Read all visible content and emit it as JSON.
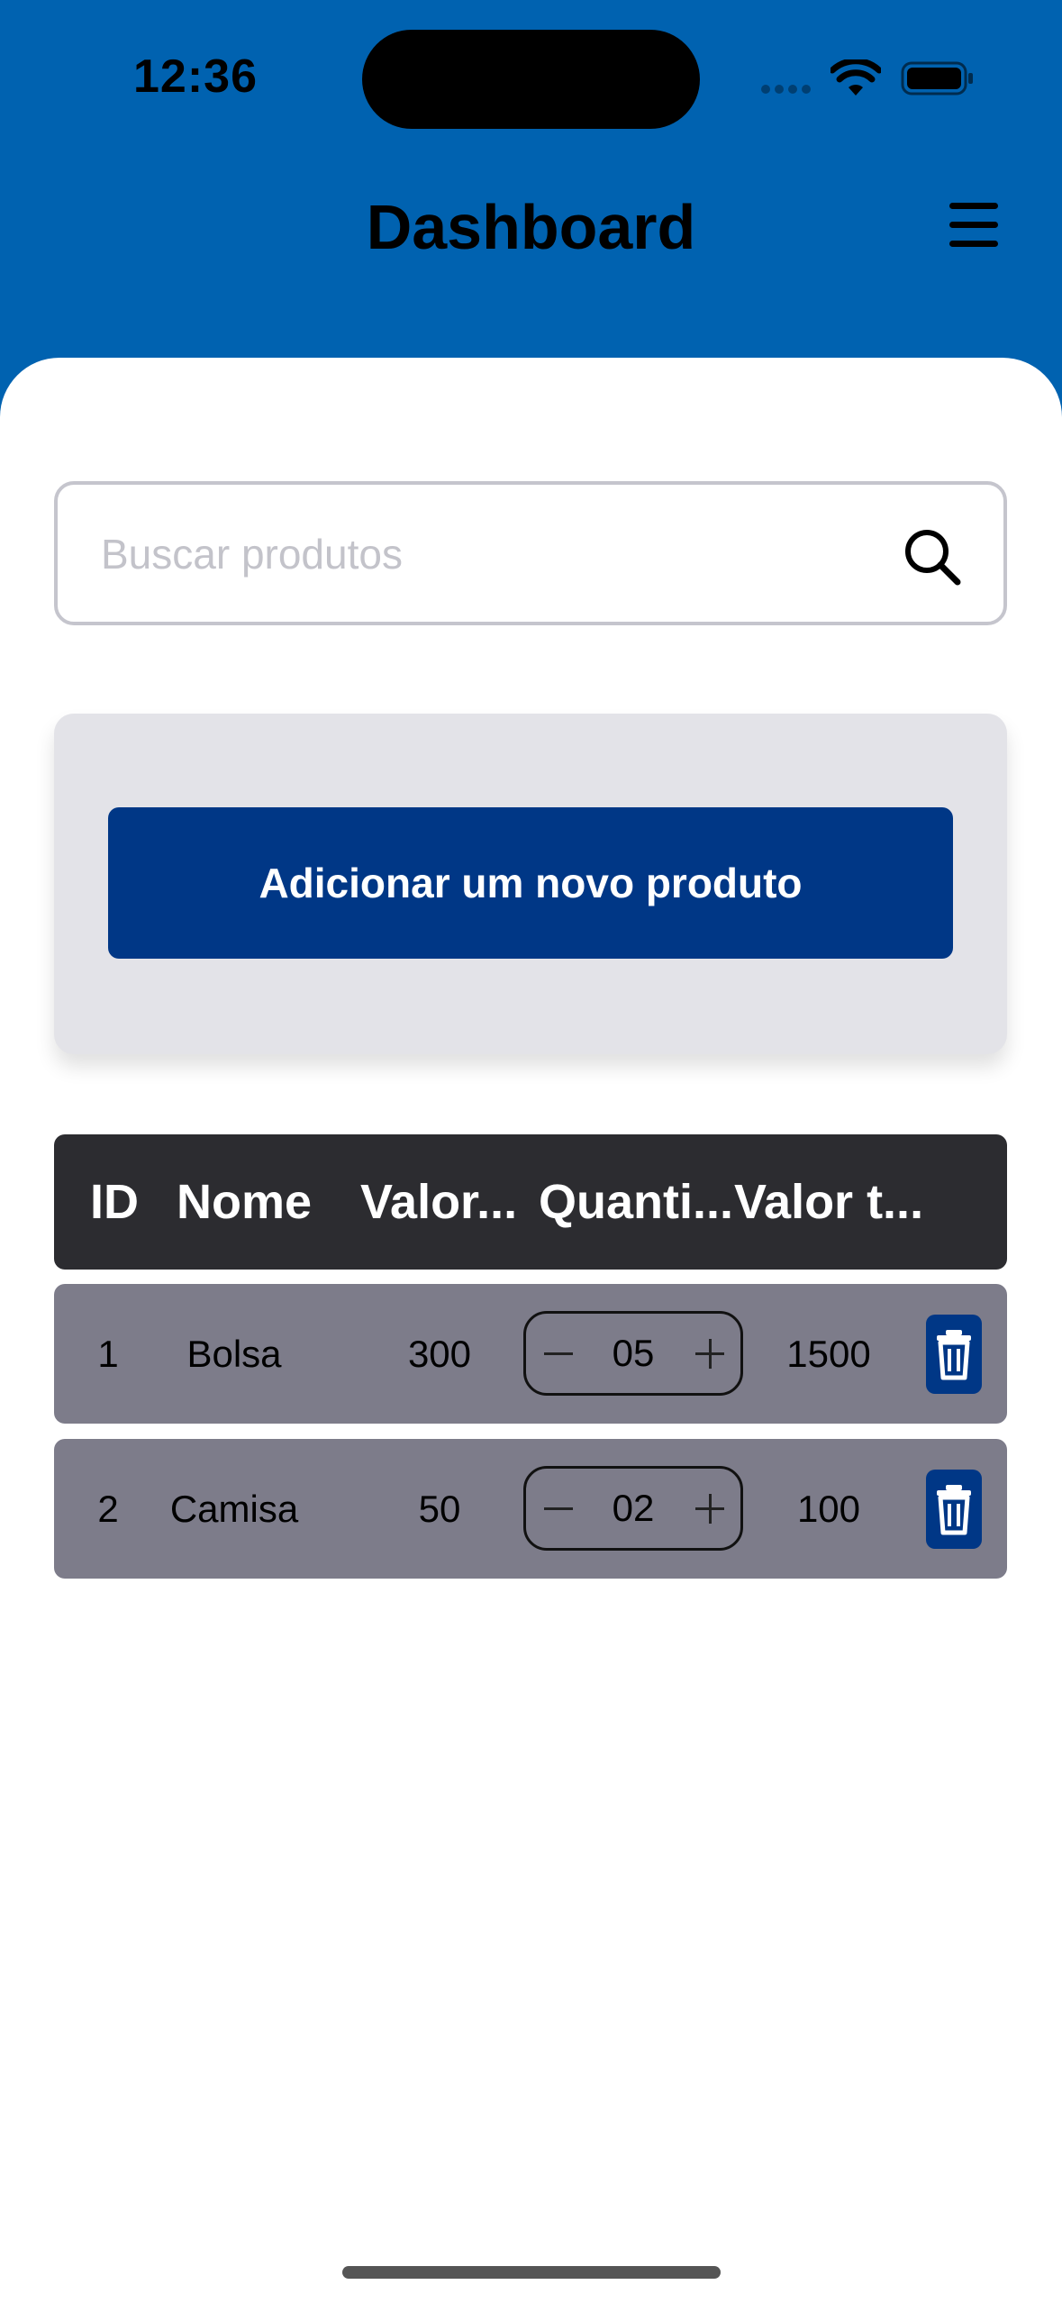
{
  "status_bar": {
    "time": "12:36"
  },
  "header": {
    "title": "Dashboard",
    "menu_icon": "hamburger-menu-icon"
  },
  "search": {
    "placeholder": "Buscar produtos",
    "value": "",
    "icon": "search-icon"
  },
  "add_product": {
    "label": "Adicionar um novo produto"
  },
  "table": {
    "headers": [
      "ID",
      "Nome",
      "Valor...",
      "Quanti...",
      "Valor t..."
    ],
    "rows": [
      {
        "id": "1",
        "name": "Bolsa",
        "value": "300",
        "quantity": "05",
        "total": "1500"
      },
      {
        "id": "2",
        "name": "Camisa",
        "value": "50",
        "quantity": "02",
        "total": "100"
      }
    ],
    "delete_icon": "trash-icon"
  },
  "colors": {
    "header_bg": "#0062B0",
    "primary_button": "#003786",
    "table_header_bg": "#2C2C30",
    "row_bg": "#7D7C8A",
    "card_bg": "#E3E3E8"
  }
}
